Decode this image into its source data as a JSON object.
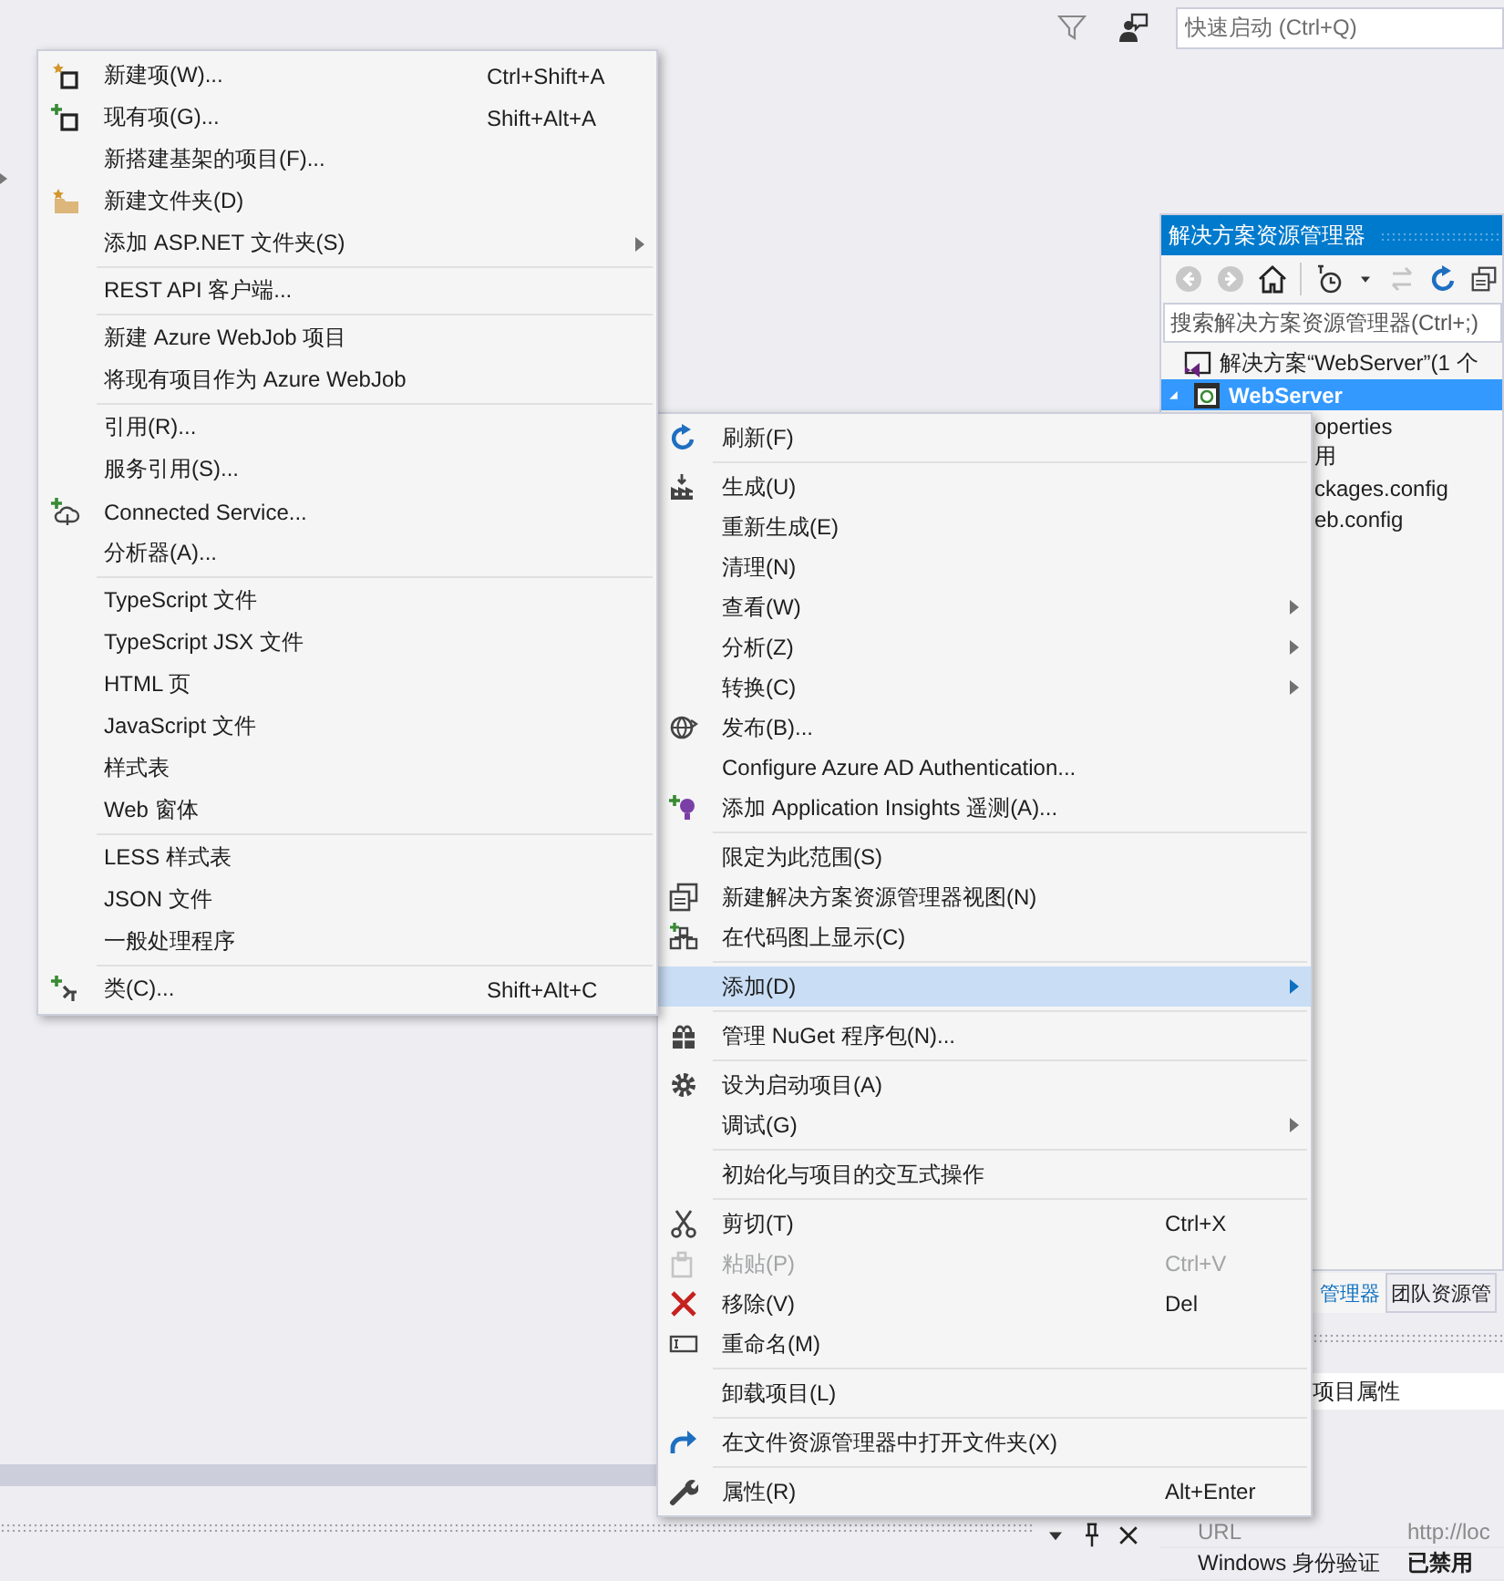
{
  "toolbar": {
    "quick_launch": {
      "placeholder": "快速启动 (Ctrl+Q)"
    }
  },
  "add_submenu": {
    "groups": [
      [
        {
          "label": "新建项(W)...",
          "shortcut": "Ctrl+Shift+A",
          "submenu": false,
          "selected": false,
          "disabled": false
        },
        {
          "label": "现有项(G)...",
          "shortcut": "Shift+Alt+A",
          "submenu": false,
          "selected": false,
          "disabled": false
        },
        {
          "label": "新搭建基架的项目(F)...",
          "submenu": false,
          "selected": false,
          "disabled": false
        },
        {
          "label": "新建文件夹(D)",
          "submenu": false,
          "selected": false,
          "disabled": false
        },
        {
          "label": "添加 ASP.NET 文件夹(S)",
          "submenu": true,
          "selected": false,
          "disabled": false
        }
      ],
      [
        {
          "label": "REST API 客户端...",
          "submenu": false,
          "selected": false,
          "disabled": false
        }
      ],
      [
        {
          "label": "新建 Azure WebJob 项目",
          "submenu": false,
          "selected": false,
          "disabled": false
        },
        {
          "label": "将现有项目作为 Azure WebJob",
          "submenu": false,
          "selected": false,
          "disabled": false
        }
      ],
      [
        {
          "label": "引用(R)...",
          "submenu": false,
          "selected": false,
          "disabled": false
        },
        {
          "label": "服务引用(S)...",
          "submenu": false,
          "selected": false,
          "disabled": false
        },
        {
          "label": "Connected Service...",
          "submenu": false,
          "selected": false,
          "disabled": false
        },
        {
          "label": "分析器(A)...",
          "submenu": false,
          "selected": false,
          "disabled": false
        }
      ],
      [
        {
          "label": "TypeScript 文件",
          "submenu": false,
          "selected": false,
          "disabled": false
        },
        {
          "label": "TypeScript JSX 文件",
          "submenu": false,
          "selected": false,
          "disabled": false
        },
        {
          "label": "HTML 页",
          "submenu": false,
          "selected": false,
          "disabled": false
        },
        {
          "label": "JavaScript 文件",
          "submenu": false,
          "selected": false,
          "disabled": false
        },
        {
          "label": "样式表",
          "submenu": false,
          "selected": false,
          "disabled": false
        },
        {
          "label": "Web 窗体",
          "submenu": false,
          "selected": false,
          "disabled": false
        }
      ],
      [
        {
          "label": "LESS 样式表",
          "submenu": false,
          "selected": false,
          "disabled": false
        },
        {
          "label": "JSON 文件",
          "submenu": false,
          "selected": false,
          "disabled": false
        },
        {
          "label": "一般处理程序",
          "submenu": false,
          "selected": false,
          "disabled": false
        }
      ],
      [
        {
          "label": "类(C)...",
          "shortcut": "Shift+Alt+C",
          "submenu": false,
          "selected": false,
          "disabled": false
        }
      ]
    ]
  },
  "solution_explorer": {
    "title": "解决方案资源管理器",
    "search": {
      "placeholder": "搜索解决方案资源管理器(Ctrl+;)"
    },
    "tree": [
      {
        "label": "解决方案“WebServer”(1 个",
        "selected": false,
        "children": [
          {
            "label": "WebServer",
            "selected": true,
            "expanded": true,
            "children": [
              {
                "label": "operties",
                "selected": false
              },
              {
                "label": "用",
                "selected": false
              },
              {
                "label": "ckages.config",
                "selected": false
              },
              {
                "label": "eb.config",
                "selected": false
              }
            ]
          }
        ]
      }
    ]
  },
  "context_menu": {
    "groups": [
      [
        {
          "label": "刷新(F)",
          "submenu": false,
          "selected": false,
          "disabled": false
        }
      ],
      [
        {
          "label": "生成(U)",
          "submenu": false,
          "selected": false,
          "disabled": false
        },
        {
          "label": "重新生成(E)",
          "submenu": false,
          "selected": false,
          "disabled": false
        },
        {
          "label": "清理(N)",
          "submenu": false,
          "selected": false,
          "disabled": false
        },
        {
          "label": "查看(W)",
          "submenu": true,
          "selected": false,
          "disabled": false
        },
        {
          "label": "分析(Z)",
          "submenu": true,
          "selected": false,
          "disabled": false
        },
        {
          "label": "转换(C)",
          "submenu": true,
          "selected": false,
          "disabled": false
        },
        {
          "label": "发布(B)...",
          "submenu": false,
          "selected": false,
          "disabled": false
        },
        {
          "label": "Configure Azure AD Authentication...",
          "submenu": false,
          "selected": false,
          "disabled": false
        },
        {
          "label": "添加 Application Insights 遥测(A)...",
          "submenu": false,
          "selected": false,
          "disabled": false
        }
      ],
      [
        {
          "label": "限定为此范围(S)",
          "submenu": false,
          "selected": false,
          "disabled": false
        },
        {
          "label": "新建解决方案资源管理器视图(N)",
          "submenu": false,
          "selected": false,
          "disabled": false
        },
        {
          "label": "在代码图上显示(C)",
          "submenu": false,
          "selected": false,
          "disabled": false
        }
      ],
      [
        {
          "label": "添加(D)",
          "submenu": true,
          "selected": true,
          "disabled": false
        }
      ],
      [
        {
          "label": "管理 NuGet 程序包(N)...",
          "submenu": false,
          "selected": false,
          "disabled": false
        }
      ],
      [
        {
          "label": "设为启动项目(A)",
          "submenu": false,
          "selected": false,
          "disabled": false
        },
        {
          "label": "调试(G)",
          "submenu": true,
          "selected": false,
          "disabled": false
        }
      ],
      [
        {
          "label": "初始化与项目的交互式操作",
          "submenu": false,
          "selected": false,
          "disabled": false
        }
      ],
      [
        {
          "label": "剪切(T)",
          "shortcut": "Ctrl+X",
          "submenu": false,
          "selected": false,
          "disabled": false
        },
        {
          "label": "粘贴(P)",
          "shortcut": "Ctrl+V",
          "submenu": false,
          "selected": false,
          "disabled": true
        },
        {
          "label": "移除(V)",
          "shortcut": "Del",
          "submenu": false,
          "selected": false,
          "disabled": false
        },
        {
          "label": "重命名(M)",
          "submenu": false,
          "selected": false,
          "disabled": false
        }
      ],
      [
        {
          "label": "卸载项目(L)",
          "submenu": false,
          "selected": false,
          "disabled": false
        }
      ],
      [
        {
          "label": "在文件资源管理器中打开文件夹(X)",
          "submenu": false,
          "selected": false,
          "disabled": false
        }
      ],
      [
        {
          "label": "属性(R)",
          "shortcut": "Alt+Enter",
          "submenu": false,
          "selected": false,
          "disabled": false
        }
      ]
    ]
  },
  "bottom_tabs": [
    {
      "label": "管理器",
      "selected": true
    },
    {
      "label": "团队资源管",
      "selected": false
    }
  ],
  "properties": {
    "object": "项目属性",
    "rows": [
      {
        "name": "URL",
        "value": "http://loc",
        "disabled": true
      },
      {
        "name": "Windows 身份验证",
        "value": "已禁用",
        "disabled": false
      }
    ]
  }
}
